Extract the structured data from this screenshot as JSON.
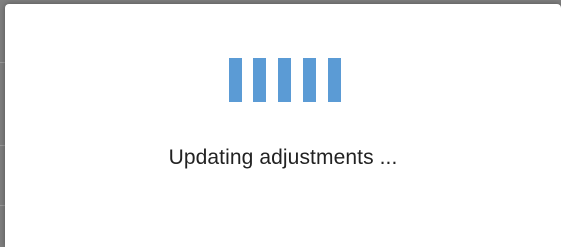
{
  "loading_dialog": {
    "message": "Updating adjustments ...",
    "spinner_icon": "loading-bars-icon",
    "spinner_color": "#5b9bd5",
    "spinner_bar_count": 5
  }
}
